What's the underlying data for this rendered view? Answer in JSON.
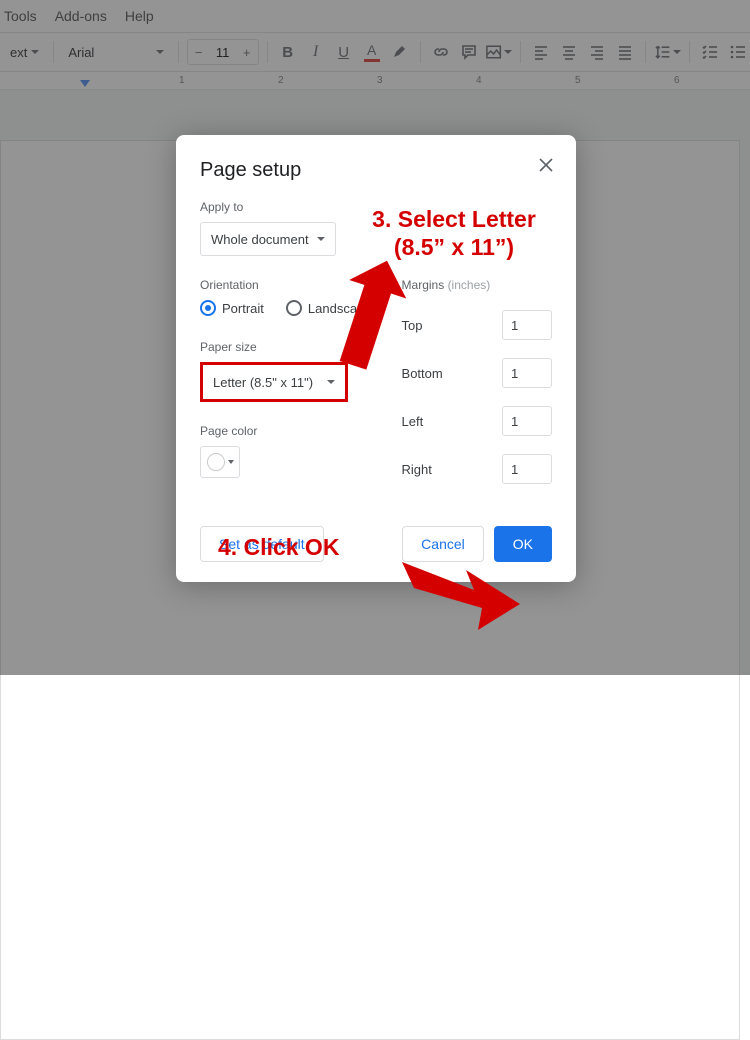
{
  "menubar": {
    "items": [
      "Tools",
      "Add-ons",
      "Help"
    ]
  },
  "toolbar": {
    "style_dropdown": "ext",
    "font_dropdown": "Arial",
    "font_size": "11"
  },
  "ruler": {
    "ticks": [
      "1",
      "2",
      "3",
      "4",
      "5",
      "6"
    ]
  },
  "dialog": {
    "title": "Page setup",
    "apply_to": {
      "label": "Apply to",
      "value": "Whole document"
    },
    "orientation": {
      "label": "Orientation",
      "portrait": "Portrait",
      "landscape": "Landscape",
      "selected": "portrait"
    },
    "paper_size": {
      "label": "Paper size",
      "value": "Letter (8.5\" x 11\")"
    },
    "page_color": {
      "label": "Page color",
      "value_hex": "#ffffff"
    },
    "margins": {
      "label": "Margins",
      "unit": "(inches)",
      "top": {
        "label": "Top",
        "value": "1"
      },
      "bottom": {
        "label": "Bottom",
        "value": "1"
      },
      "left": {
        "label": "Left",
        "value": "1"
      },
      "right": {
        "label": "Right",
        "value": "1"
      }
    },
    "actions": {
      "set_default": "Set as default",
      "cancel": "Cancel",
      "ok": "OK"
    }
  },
  "annotations": {
    "step3_line1": "3. Select Letter",
    "step3_line2": "(8.5” x 11”)",
    "step4": "4. Click OK"
  }
}
